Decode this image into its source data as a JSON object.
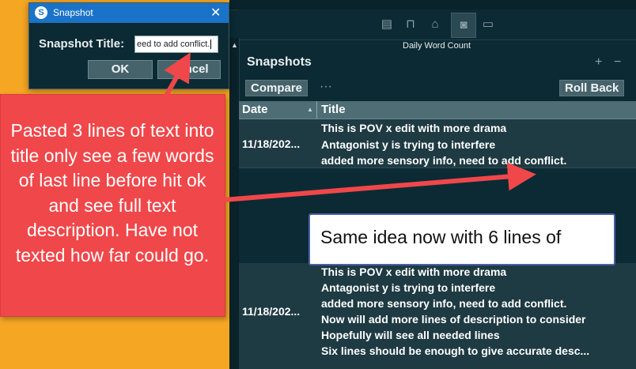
{
  "dialog": {
    "title": "Snapshot",
    "close_icon": "close-icon",
    "label": "Snapshot Title:",
    "input_value": "eed to add conflict.",
    "ok_label": "OK",
    "cancel_label": "Cancel"
  },
  "panel": {
    "toolbar_icons": [
      "notes-icon",
      "bookmark-icon",
      "keyword-icon",
      "camera-icon",
      "comment-icon"
    ],
    "daily_word_count": "Daily Word Count",
    "title": "Snapshots",
    "plus": "+",
    "minus": "−",
    "compare_label": "Compare",
    "more_label": "···",
    "rollback_label": "Roll Back",
    "columns": [
      "Date",
      "Title"
    ],
    "rows": [
      {
        "date": "11/18/202...",
        "lines": [
          "This is POV x edit with more drama",
          "Antagonist y is trying to interfere",
          "added more sensory info, need to add conflict."
        ]
      },
      {
        "date": "11/18/202...",
        "lines": [
          "This is POV x edit with more drama",
          "Antagonist y is trying to interfere",
          "added more sensory info, need to add conflict.",
          "Now will add more lines of description to consider",
          "Hopefully will see all needed lines",
          "Six lines should be enough to give accurate desc..."
        ]
      }
    ]
  },
  "annotations": {
    "red_callout": "Pasted 3 lines of text into title only see a few words of last line before hit ok and see full text description. Have not texted how far could go.",
    "white_callout": "Same idea now with 6 lines of"
  },
  "colors": {
    "annotation_orange": "#f5a623",
    "callout_red": "#f0474a",
    "panel_dark": "#0c2a33",
    "titlebar_blue": "#1a73c8"
  }
}
